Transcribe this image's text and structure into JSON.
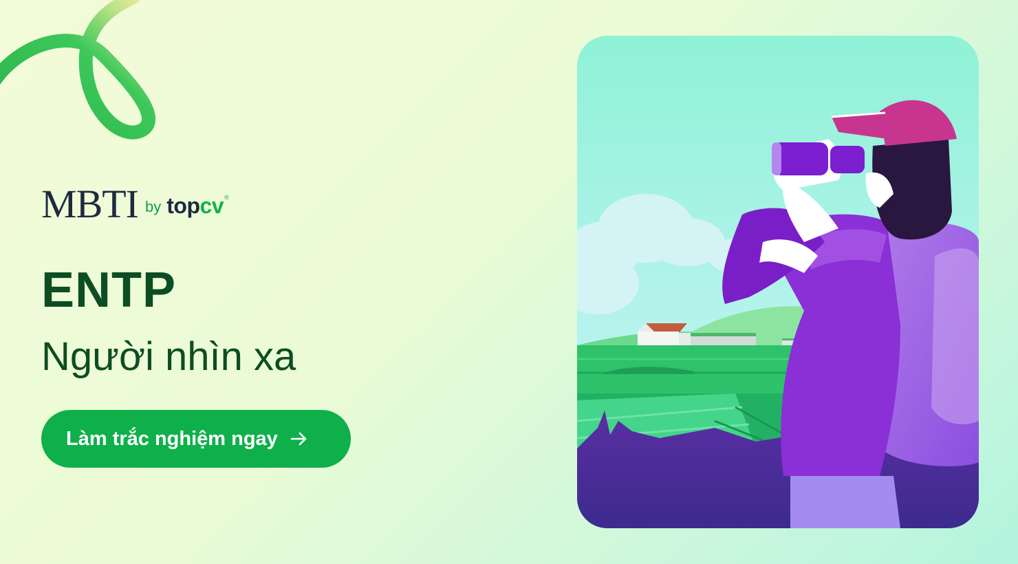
{
  "brand": {
    "mbti": "MBTI",
    "by": "by",
    "top": "top",
    "cv": "cv",
    "registered": "®"
  },
  "hero": {
    "type_code": "ENTP",
    "type_name": "Người nhìn xa"
  },
  "cta": {
    "label": "Làm trắc nghiệm ngay",
    "icon": "arrow-right-icon"
  },
  "colors": {
    "accent_green": "#0fb04b",
    "dark_green": "#0d4d23",
    "navy": "#1d2a3f",
    "purple": "#8b2fd6"
  }
}
